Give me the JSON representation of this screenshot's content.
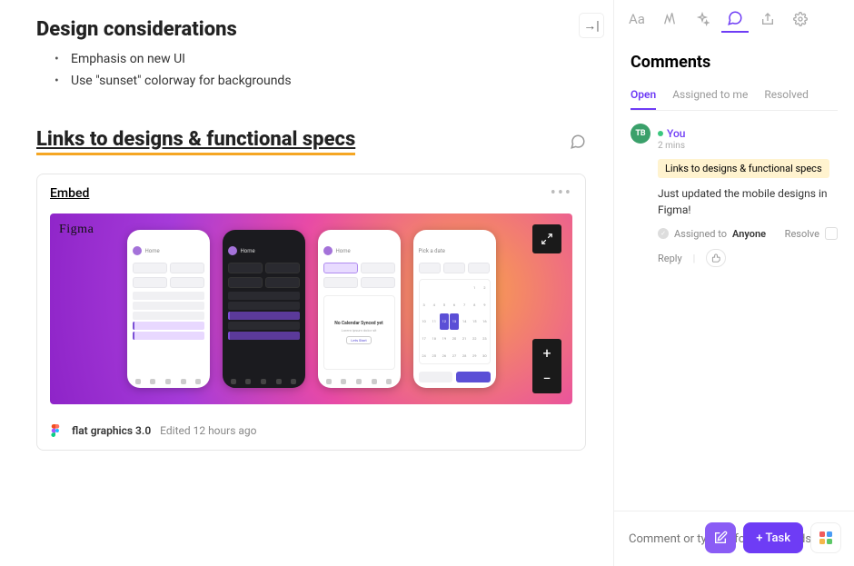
{
  "main": {
    "heading1": "Design considerations",
    "bullets": [
      "Emphasis on new UI",
      "Use \"sunset\" colorway for backgrounds"
    ],
    "heading2": "Links to designs & functional specs",
    "embed": {
      "title": "Embed",
      "brand": "Figma",
      "file_name": "flat graphics 3.0",
      "edited": "Edited 12 hours ago"
    }
  },
  "toolbar": {
    "items": [
      "text-style",
      "ai",
      "sparkle",
      "comments",
      "share",
      "settings"
    ],
    "active": "comments"
  },
  "comments": {
    "title": "Comments",
    "tabs": [
      "Open",
      "Assigned to me",
      "Resolved"
    ],
    "active_tab": "Open",
    "thread": {
      "avatar_initials": "TB",
      "author": "You",
      "time": "2 mins",
      "reference": "Links to designs & functional specs",
      "body": "Just updated the mobile designs in Figma!",
      "assigned_label": "Assigned to",
      "assigned_to": "Anyone",
      "resolve": "Resolve",
      "reply": "Reply"
    },
    "input_placeholder": "Comment or type '/' for commands"
  },
  "actions": {
    "task_button": "+ Task"
  }
}
